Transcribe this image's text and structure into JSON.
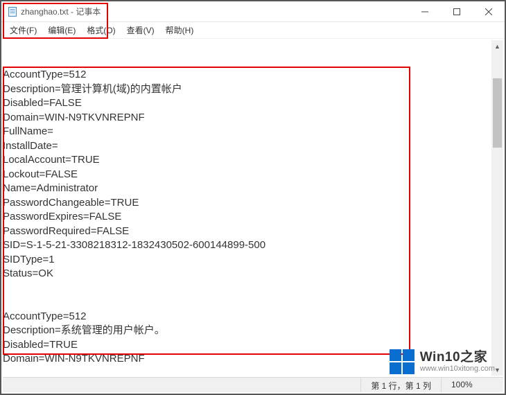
{
  "window": {
    "title": "zhanghao.txt - 记事本",
    "controls": {
      "min": "min",
      "max": "max",
      "close": "close"
    }
  },
  "menu": {
    "file": "文件(F)",
    "edit": "编辑(E)",
    "format": "格式(O)",
    "view": "查看(V)",
    "help": "帮助(H)"
  },
  "doc": {
    "lines": [
      "AccountType=512",
      "Description=管理计算机(域)的内置帐户",
      "Disabled=FALSE",
      "Domain=WIN-N9TKVNREPNF",
      "FullName=",
      "InstallDate=",
      "LocalAccount=TRUE",
      "Lockout=FALSE",
      "Name=Administrator",
      "PasswordChangeable=TRUE",
      "PasswordExpires=FALSE",
      "PasswordRequired=FALSE",
      "SID=S-1-5-21-3308218312-1832430502-600144899-500",
      "SIDType=1",
      "Status=OK",
      "",
      "",
      "AccountType=512",
      "Description=系统管理的用户帐户。",
      "Disabled=TRUE",
      "Domain=WIN-N9TKVNREPNF"
    ]
  },
  "status": {
    "pos": "第 1 行，第 1 列",
    "zoom": "100%"
  },
  "watermark": {
    "brand": "Win10之家",
    "url": "www.win10xitong.com"
  }
}
